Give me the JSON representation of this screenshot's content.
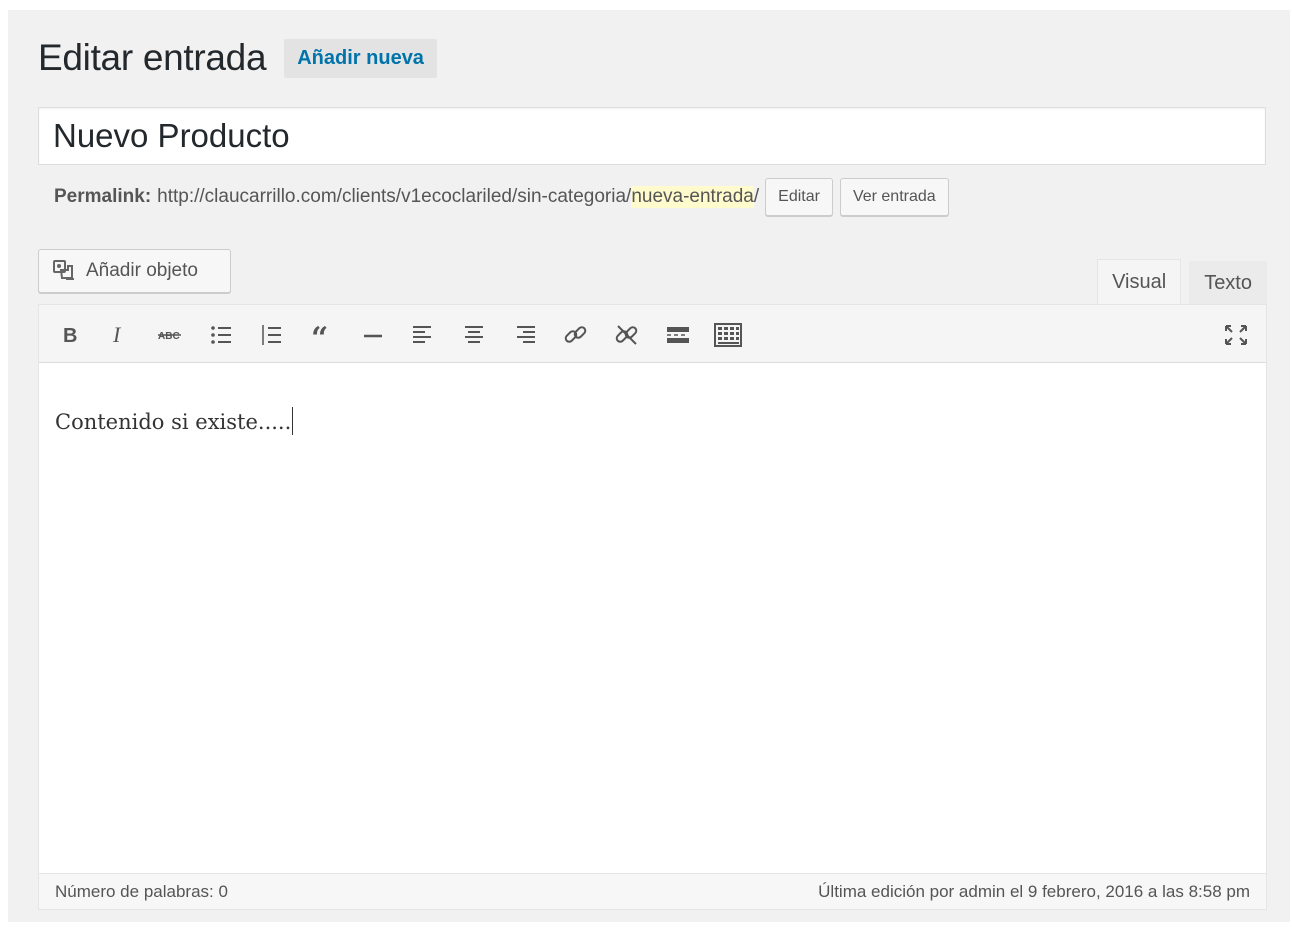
{
  "header": {
    "title": "Editar entrada",
    "add_new_label": "Añadir nueva"
  },
  "post": {
    "title_value": "Nuevo Producto"
  },
  "permalink": {
    "label": "Permalink:",
    "base_url": "http://claucarrillo.com/clients/v1ecoclariled/sin-categoria/",
    "slug": "nueva-entrada",
    "trailing": "/",
    "edit_label": "Editar",
    "view_label": "Ver entrada",
    "slug_highlight_color": "#fffbcc"
  },
  "media": {
    "add_media_label": "Añadir objeto",
    "icon": "add-media-icon"
  },
  "editor_tabs": [
    {
      "label": "Visual",
      "active": true
    },
    {
      "label": "Texto",
      "active": false
    }
  ],
  "toolbar": {
    "buttons": [
      "bold-icon",
      "italic-icon",
      "strikethrough-icon",
      "bulleted-list-icon",
      "numbered-list-icon",
      "blockquote-icon",
      "horizontal-line-icon",
      "align-left-icon",
      "align-center-icon",
      "align-right-icon",
      "insert-link-icon",
      "remove-link-icon",
      "read-more-icon",
      "toolbar-toggle-icon",
      "fullscreen-icon"
    ]
  },
  "editor": {
    "content": "Contenido si existe....."
  },
  "status": {
    "word_count": "Número de palabras: 0",
    "last_edit": "Última edición por admin el 9 febrero, 2016 a las 8:58 pm"
  },
  "colors": {
    "link_blue": "#0073aa",
    "background": "#f1f1f1"
  }
}
